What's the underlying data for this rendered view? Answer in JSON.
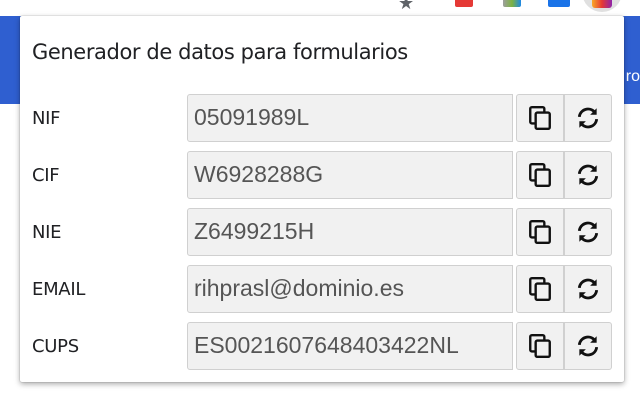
{
  "browser": {
    "page_band_text": "ro"
  },
  "popup": {
    "title": "Generador de datos para formularios",
    "rows": [
      {
        "label": "NIF",
        "value": "05091989L"
      },
      {
        "label": "CIF",
        "value": "W6928288G"
      },
      {
        "label": "NIE",
        "value": "Z6499215H"
      },
      {
        "label": "EMAIL",
        "value": "rihprasl@dominio.es"
      },
      {
        "label": "CUPS",
        "value": "ES0021607648403422NL"
      }
    ],
    "icons": {
      "copy": "copy-icon",
      "refresh": "refresh-icon"
    }
  },
  "colors": {
    "page_band": "#2f5fd0",
    "field_bg": "#f1f1f1",
    "field_border": "#d0d0d0",
    "text": "#202124"
  }
}
